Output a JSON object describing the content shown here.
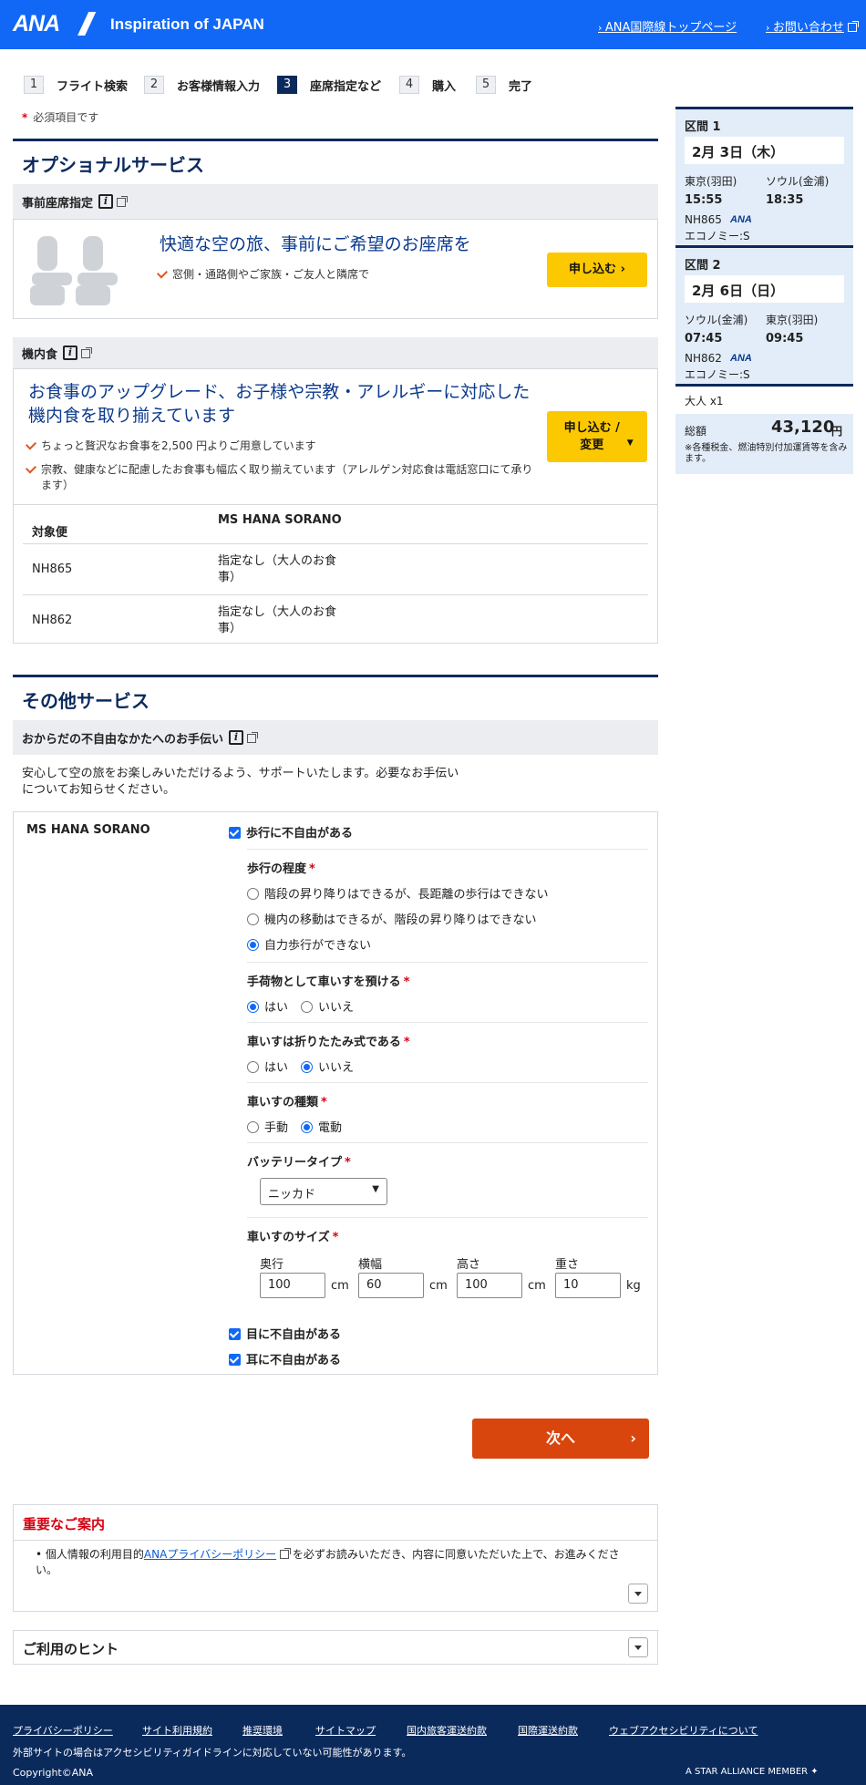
{
  "header": {
    "logo": "ANA",
    "tagline": "Inspiration of JAPAN",
    "links": [
      "ANA国際線トップページ",
      "お問い合わせ"
    ]
  },
  "steps": [
    {
      "num": "1",
      "label": "フライト検索"
    },
    {
      "num": "2",
      "label": "お客様情報入力"
    },
    {
      "num": "3",
      "label": "座席指定など"
    },
    {
      "num": "4",
      "label": "購入"
    },
    {
      "num": "5",
      "label": "完了"
    }
  ],
  "required_note": "必須項目です",
  "optional": {
    "title": "オプショナルサービス",
    "seat": {
      "label": "事前座席指定",
      "headline": "快適な空の旅、事前にご希望のお座席を",
      "bullet": "窓側・通路側やご家族・ご友人と隣席で",
      "button": "申し込む"
    },
    "meal": {
      "label": "機内食",
      "headline": "お食事のアップグレード、お子様や宗教・アレルギーに対応した機内食を取り揃えています",
      "bullets": [
        "ちょっと贅沢なお食事を2,500 円よりご用意しています",
        "宗教、健康などに配慮したお食事も幅広く取り揃えています（アレルゲン対応食は電話窓口にて承ります）"
      ],
      "button": "申し込む / 変更",
      "table": {
        "col1": "対象便",
        "col2": "MS HANA SORANO",
        "rows": [
          {
            "flight": "NH865",
            "meal": "指定なし（大人のお食事）"
          },
          {
            "flight": "NH862",
            "meal": "指定なし（大人のお食事）"
          }
        ]
      }
    }
  },
  "other": {
    "title": "その他サービス",
    "assist_label": "おからだの不自由なかたへのお手伝い",
    "assist_desc": "安心して空の旅をお楽しみいただけるよう、サポートいたします。必要なお手伝いについてお知らせください。",
    "passenger": "MS HANA SORANO",
    "walk_check": "歩行に不自由がある",
    "walk_level": {
      "label": "歩行の程度",
      "options": [
        "階段の昇り降りはできるが、長距離の歩行はできない",
        "機内の移動はできるが、階段の昇り降りはできない",
        "自力歩行ができない"
      ],
      "selected": 2
    },
    "checkin_wc": {
      "label": "手荷物として車いすを預ける",
      "options": [
        "はい",
        "いいえ"
      ],
      "selected": 0
    },
    "foldable": {
      "label": "車いすは折りたたみ式である",
      "options": [
        "はい",
        "いいえ"
      ],
      "selected": 1
    },
    "wc_type": {
      "label": "車いすの種類",
      "options": [
        "手動",
        "電動"
      ],
      "selected": 1
    },
    "battery": {
      "label": "バッテリータイプ",
      "value": "ニッカド"
    },
    "size": {
      "label": "車いすのサイズ",
      "fields": [
        {
          "name": "奥行",
          "value": "100",
          "unit": "cm"
        },
        {
          "name": "横幅",
          "value": "60",
          "unit": "cm"
        },
        {
          "name": "高さ",
          "value": "100",
          "unit": "cm"
        },
        {
          "name": "重さ",
          "value": "10",
          "unit": "kg"
        }
      ]
    },
    "eye": "目に不自由がある",
    "ear": "耳に不自由がある"
  },
  "next_button": "次へ",
  "notice": {
    "title": "重要なご案内",
    "text_pre": "個人情報の利用目的",
    "link": "ANAプライバシーポリシー",
    "text_post": "を必ずお読みいただき、内容に同意いただいた上で、お進みください。"
  },
  "hints": "ご利用のヒント",
  "sidebar": {
    "seg1": {
      "label": "区間 1",
      "date": "2月 3日（木）",
      "from": "東京(羽田)",
      "to": "ソウル(金浦)",
      "dep": "15:55",
      "arr": "18:35",
      "flight": "NH865",
      "cls": "エコノミー:S"
    },
    "seg2": {
      "label": "区間 2",
      "date": "2月 6日（日）",
      "from": "ソウル(金浦)",
      "to": "東京(羽田)",
      "dep": "07:45",
      "arr": "09:45",
      "flight": "NH862",
      "cls": "エコノミー:S"
    },
    "pax": "大人 x1",
    "total_label": "総額",
    "total": "43,120",
    "currency": "円",
    "tax_note": "※各種税金、燃油特別付加運賃等を含みます。"
  },
  "footer": {
    "links": [
      "プライバシーポリシー",
      "サイト利用規約",
      "推奨環境",
      "サイトマップ",
      "国内旅客運送約款",
      "国際運送約款",
      "ウェブアクセシビリティについて"
    ],
    "note": "外部サイトの場合はアクセシビリティガイドラインに対応していない可能性があります。",
    "copyright": "Copyright©ANA",
    "alliance": "A STAR ALLIANCE MEMBER"
  },
  "colors": {
    "brand": "#1168f6",
    "navy": "#0b2a5c",
    "cta": "#fcc800",
    "next": "#d9460d",
    "required": "#d7000f"
  }
}
